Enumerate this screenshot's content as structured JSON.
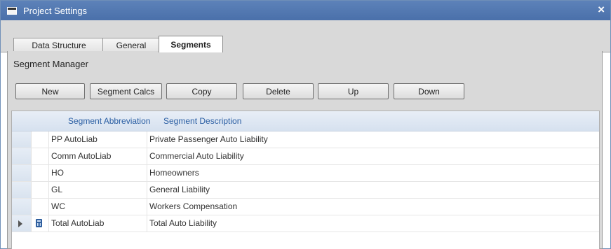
{
  "window": {
    "title": "Project Settings",
    "close_label": "×"
  },
  "tabs": [
    {
      "label": "Data Structure"
    },
    {
      "label": "General"
    },
    {
      "label": "Segments"
    }
  ],
  "panel": {
    "title": "Segment Manager"
  },
  "buttons": {
    "new": "New",
    "segment_calcs": "Segment Calcs",
    "copy": "Copy",
    "delete": "Delete",
    "up": "Up",
    "down": "Down"
  },
  "grid": {
    "columns": [
      "Segment Abbreviation",
      "Segment Description"
    ],
    "rows": [
      {
        "abbr": "PP AutoLiab",
        "desc": "Private Passenger Auto Liability"
      },
      {
        "abbr": "Comm AutoLiab",
        "desc": "Commercial Auto Liability"
      },
      {
        "abbr": "HO",
        "desc": "Homeowners"
      },
      {
        "abbr": "GL",
        "desc": "General Liability"
      },
      {
        "abbr": "WC",
        "desc": "Workers Compensation"
      },
      {
        "abbr": "Total AutoLiab",
        "desc": "Total Auto Liability",
        "current": true,
        "icon": "calculator-icon"
      }
    ]
  }
}
